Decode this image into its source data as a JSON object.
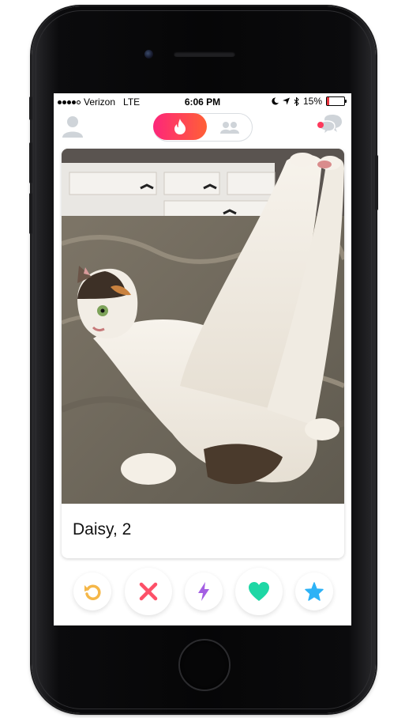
{
  "status_bar": {
    "carrier": "Verizon",
    "network": "LTE",
    "time": "6:06 PM",
    "battery": "15%",
    "battery_level": 0.15
  },
  "top_nav": {
    "left_icon": "profile-icon",
    "toggle_active": "flame-icon",
    "toggle_inactive": "group-icon",
    "right_icon": "messages-icon"
  },
  "card": {
    "name_age": "Daisy, 2",
    "photo": "calico cat lying on bed with hind legs raised"
  },
  "actions": [
    {
      "name": "rewind-button",
      "icon": "rewind-icon",
      "color": "#f5b748"
    },
    {
      "name": "nope-button",
      "icon": "x-icon",
      "color": "#fd5068"
    },
    {
      "name": "boost-button",
      "icon": "lightning-icon",
      "color": "#a45fe3"
    },
    {
      "name": "like-button",
      "icon": "heart-icon",
      "color": "#1ed7a5"
    },
    {
      "name": "super-like-button",
      "icon": "star-icon",
      "color": "#2db2f6"
    }
  ],
  "colors": {
    "brand_pink": "#fd267a",
    "brand_orange": "#ff6036",
    "chat_dot": "#fd3a5c"
  }
}
